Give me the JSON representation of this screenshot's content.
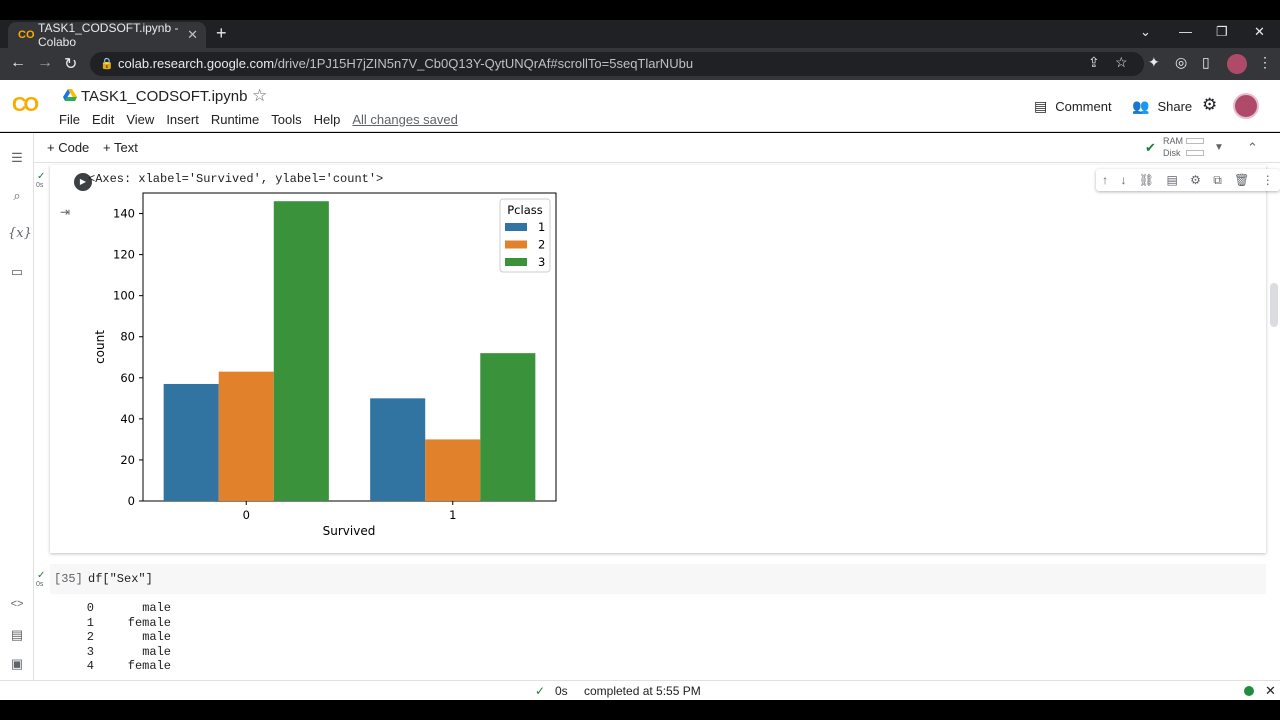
{
  "browser": {
    "tab_title": "TASK1_CODSOFT.ipynb - Colabo",
    "url_host": "colab.research.google.com",
    "url_path": "/drive/1PJ15H7jZIN5n7V_Cb0Q13Y-QytUNQrAf#scrollTo=5seqTlarNUbu"
  },
  "header": {
    "notebook_title": "TASK1_CODSOFT.ipynb",
    "menu": [
      "File",
      "Edit",
      "View",
      "Insert",
      "Runtime",
      "Tools",
      "Help"
    ],
    "save_status": "All changes saved",
    "comment_label": "Comment",
    "share_label": "Share"
  },
  "toolbar": {
    "add_code": "+ Code",
    "add_text": "+ Text",
    "ram_label": "RAM",
    "disk_label": "Disk"
  },
  "cell1": {
    "exec_time": "0s",
    "output_text": "<Axes: xlabel='Survived', ylabel='count'>"
  },
  "cell2": {
    "exec_time": "0s",
    "prompt": "[35]",
    "code": "df[\"Sex\"]",
    "rows": [
      {
        "index": "0",
        "value": "male"
      },
      {
        "index": "1",
        "value": "female"
      },
      {
        "index": "2",
        "value": "male"
      },
      {
        "index": "3",
        "value": "male"
      },
      {
        "index": "4",
        "value": "female"
      }
    ]
  },
  "status": {
    "time": "0s",
    "message": "completed at 5:55 PM"
  },
  "chart_data": {
    "type": "bar",
    "categories": [
      "0",
      "1"
    ],
    "xlabel": "Survived",
    "ylabel": "count",
    "ylim": [
      0,
      150
    ],
    "yticks": [
      0,
      20,
      40,
      60,
      80,
      100,
      120,
      140
    ],
    "legend_title": "Pclass",
    "legend_position": "top-right",
    "series": [
      {
        "name": "1",
        "color": "#3274a1",
        "values": [
          57,
          50
        ]
      },
      {
        "name": "2",
        "color": "#e1812c",
        "values": [
          63,
          30
        ]
      },
      {
        "name": "3",
        "color": "#3a923a",
        "values": [
          146,
          72
        ]
      }
    ]
  }
}
